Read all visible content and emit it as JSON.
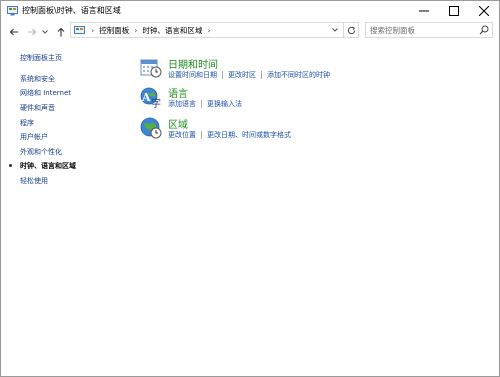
{
  "window": {
    "title": "控制面板\\时钟、语言和区域",
    "controls": [
      "minimize",
      "maximize",
      "close"
    ]
  },
  "nav": {
    "back_icon": "arrow-left-icon",
    "forward_icon": "arrow-right-icon",
    "recent_icon": "chevron-down-icon",
    "up_icon": "arrow-up-icon"
  },
  "address": {
    "crumbs": [
      "控制面板",
      "时钟、语言和区域"
    ]
  },
  "search": {
    "placeholder": "搜索控制面板"
  },
  "sidebar": {
    "home": "控制面板主页",
    "items": [
      {
        "label": "系统和安全"
      },
      {
        "label": "网络和 Internet"
      },
      {
        "label": "硬件和声音"
      },
      {
        "label": "程序"
      },
      {
        "label": "用户帐户"
      },
      {
        "label": "外观和个性化"
      },
      {
        "label": "时钟、语言和区域",
        "current": true
      },
      {
        "label": "轻松使用"
      }
    ]
  },
  "categories": [
    {
      "title": "日期和时间",
      "icon": "calendar-clock-icon",
      "links": [
        "设置时间和日期",
        "更改时区",
        "添加不同时区的时钟"
      ]
    },
    {
      "title": "语言",
      "icon": "language-icon",
      "links": [
        "添加语言",
        "更换输入法"
      ]
    },
    {
      "title": "区域",
      "icon": "globe-clock-icon",
      "links": [
        "更改位置",
        "更改日期、时间或数字格式"
      ]
    }
  ],
  "colors": {
    "link": "#1a4fa8",
    "category_title": "#1e8b1e",
    "nav_link": "#1a3d8a"
  }
}
